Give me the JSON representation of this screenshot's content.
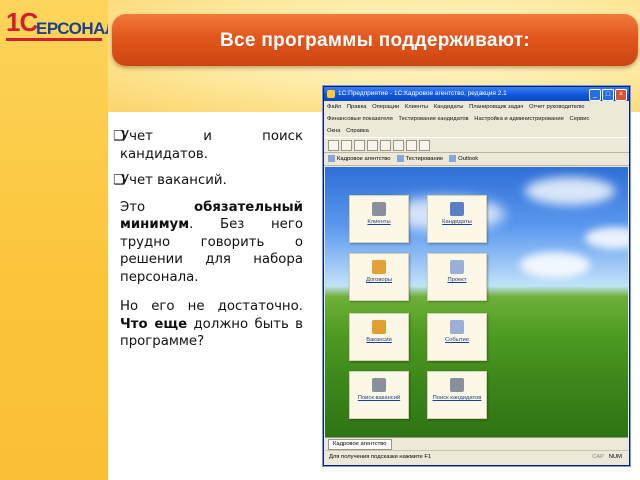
{
  "logo": {
    "prefix": "1С",
    "text": "ЕРСОНАЛ",
    "full": "1С ПЕРСОНАЛ"
  },
  "header": {
    "title": "Все программы поддерживают:"
  },
  "content": {
    "bullets": [
      "Учет и поиск кандидатов.",
      "Учет вакансий."
    ],
    "bullet_1_line1_words": [
      "Учет",
      "и",
      "поиск"
    ],
    "bullet_1_line2": "кандидатов.",
    "para1": {
      "pre": "Это ",
      "bold": "обязательный минимум",
      "post": ". Без него трудно говорить о решении для набора персонала."
    },
    "para2": {
      "pre": "Но его не достаточно. ",
      "bold": "Что еще",
      "post": " должно быть в программе?"
    }
  },
  "app": {
    "window_title": "1С:Предприятие - 1С:Кадровое агентство, редакция 2.1",
    "menu_row1": [
      "Файл",
      "Правка",
      "Операции",
      "Клиенты",
      "Кандидаты",
      "Планировщик задач",
      "Отчет руководителю"
    ],
    "menu_row2": [
      "Финансовые показатели",
      "Тестирование кандидатов",
      "Настройка и администрирование",
      "Сервис"
    ],
    "menu_row3": [
      "Окна",
      "Справка"
    ],
    "toolbar2": [
      "Кадровое агентство",
      "Тестирование",
      "Outlook"
    ],
    "tiles": [
      {
        "label": "Клиенты",
        "color": "#8a8f9e"
      },
      {
        "label": "Кандидаты",
        "color": "#5b7fc4"
      },
      {
        "label": "Договоры",
        "color": "#e2a23a"
      },
      {
        "label": "Проект",
        "color": "#9ab0d6"
      },
      {
        "label": "Вакансии",
        "color": "#e0a030"
      },
      {
        "label": "Событие",
        "color": "#9ab0d6"
      },
      {
        "label": "Поиск вакансий",
        "color": "#8a8f9e"
      },
      {
        "label": "Поиск кандидатов",
        "color": "#8a8f9e"
      }
    ],
    "tab": "Кадровое агентство",
    "status": "Для получения подсказки нажмите F1",
    "cap": "CAP",
    "num": "NUM"
  },
  "colors": {
    "accent": "#e2571d",
    "sidebar": "#fbc43a",
    "brand_blue": "#1d3f8f",
    "brand_red": "#d21f2d"
  }
}
